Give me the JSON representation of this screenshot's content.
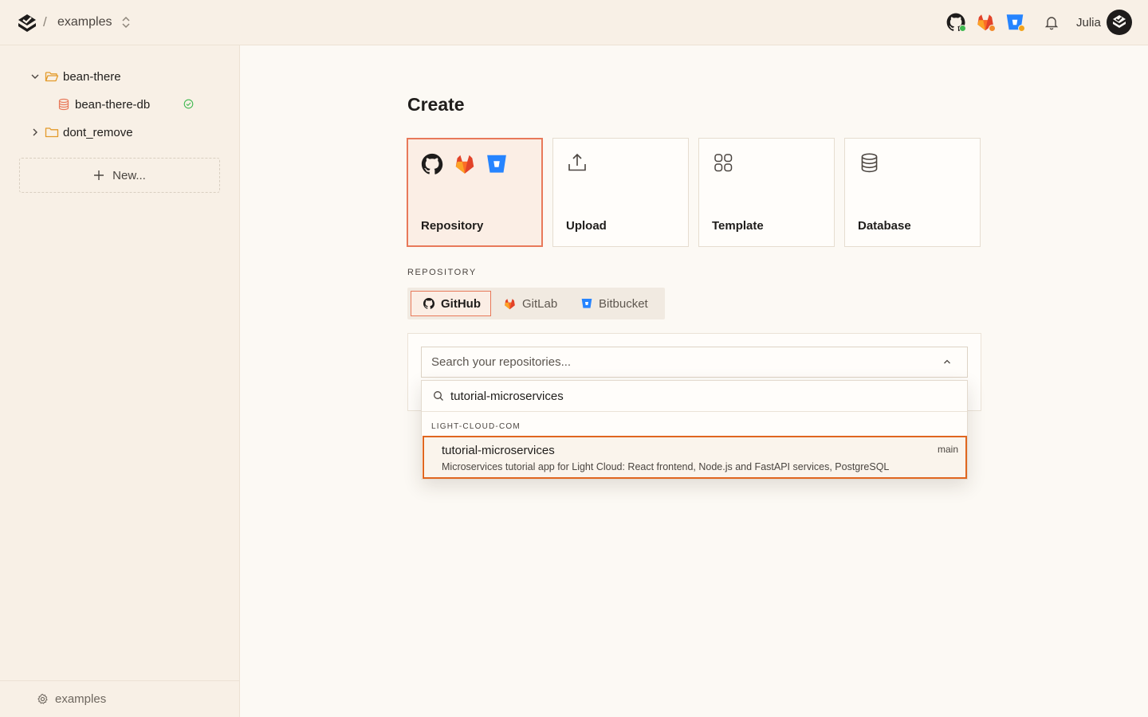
{
  "header": {
    "breadcrumb_separator": "/",
    "project_name": "examples",
    "user_name": "Julia",
    "colors": {
      "github_status": "#3fb950",
      "gitlab_status": "#f28b2c",
      "bitbucket_status": "#f2a41c"
    }
  },
  "sidebar": {
    "tree": [
      {
        "label": "bean-there",
        "type": "folder",
        "expanded": true
      },
      {
        "label": "bean-there-db",
        "type": "database",
        "status": "ok"
      },
      {
        "label": "dont_remove",
        "type": "folder",
        "expanded": false
      }
    ],
    "new_button_label": "New...",
    "footer_label": "examples"
  },
  "main": {
    "title": "Create",
    "cards": [
      {
        "label": "Repository",
        "selected": true
      },
      {
        "label": "Upload",
        "selected": false
      },
      {
        "label": "Template",
        "selected": false
      },
      {
        "label": "Database",
        "selected": false
      }
    ],
    "section_label": "REPOSITORY",
    "providers": [
      {
        "label": "GitHub",
        "selected": true
      },
      {
        "label": "GitLab",
        "selected": false
      },
      {
        "label": "Bitbucket",
        "selected": false
      }
    ],
    "select_placeholder": "Search your repositories...",
    "search_value": "tutorial-microservices",
    "group_label": "LIGHT-CLOUD-COM",
    "result": {
      "name": "tutorial-microservices",
      "description": "Microservices tutorial app for Light Cloud: React frontend, Node.js and FastAPI services, PostgreSQL",
      "branch": "main"
    }
  },
  "colors": {
    "accent": "#e0661f",
    "selected_border": "#e8795a",
    "selected_bg": "#fbeee5",
    "background": "#fcf9f4",
    "sidebar_bg": "#f8f0e6"
  }
}
